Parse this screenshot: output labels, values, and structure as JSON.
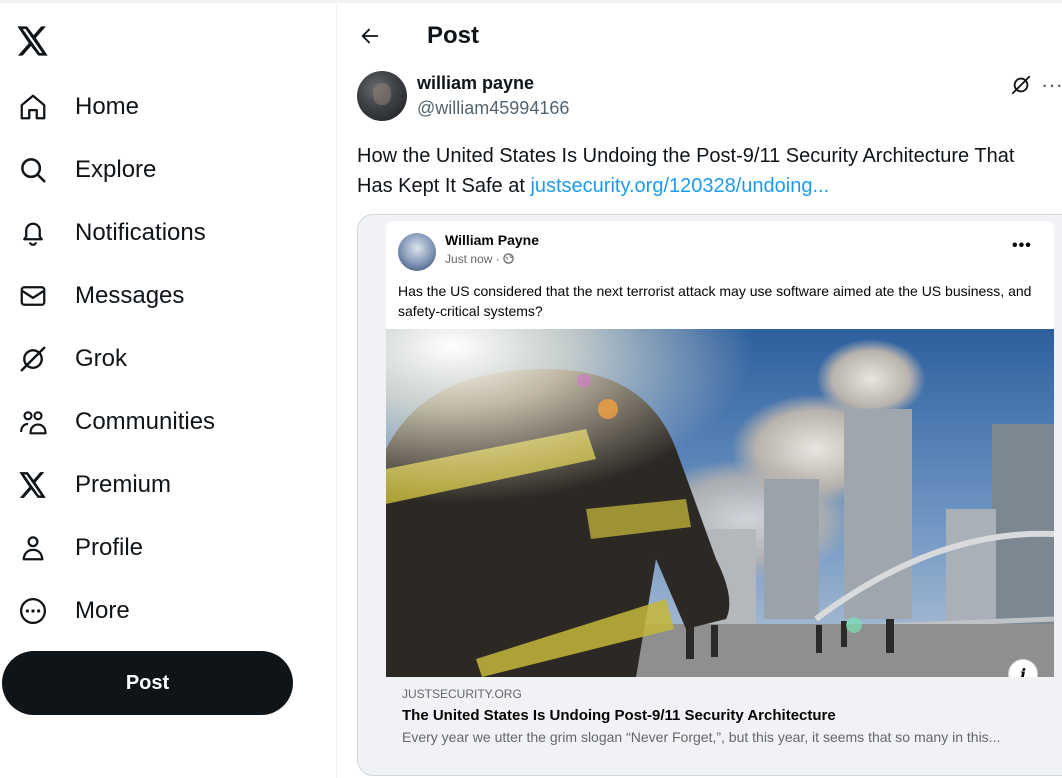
{
  "nav": {
    "items": [
      {
        "label": "Home",
        "icon": "home-icon"
      },
      {
        "label": "Explore",
        "icon": "search-icon"
      },
      {
        "label": "Notifications",
        "icon": "bell-icon"
      },
      {
        "label": "Messages",
        "icon": "envelope-icon"
      },
      {
        "label": "Grok",
        "icon": "grok-icon"
      },
      {
        "label": "Communities",
        "icon": "communities-icon"
      },
      {
        "label": "Premium",
        "icon": "x-logo-icon"
      },
      {
        "label": "Profile",
        "icon": "person-icon"
      },
      {
        "label": "More",
        "icon": "more-circle-icon"
      }
    ],
    "post_button": "Post"
  },
  "header": {
    "title": "Post"
  },
  "tweet": {
    "author_name": "william payne",
    "author_handle": "@william45994166",
    "more": "···",
    "text": "How the United States Is Undoing the Post-9/11 Security Architecture That Has Kept It Safe at ",
    "link_text": "justsecurity.org/120328/undoing..."
  },
  "embed": {
    "name": "William Payne",
    "time": "Just now ·",
    "dots": "•••",
    "text": "Has the US considered that the next terrorist attack may use software aimed ate the US business, and safety-critical systems?",
    "info": "i",
    "link_domain": "JUSTSECURITY.ORG",
    "link_title": "The United States Is Undoing Post-9/11 Security Architecture",
    "link_desc": "Every year we utter the grim slogan “Never Forget,”, but this year, it seems that so many in this..."
  },
  "colors": {
    "accent": "#1d9bf0",
    "text": "#0f1419",
    "muted": "#536471",
    "post_button_bg": "#0f1419"
  }
}
